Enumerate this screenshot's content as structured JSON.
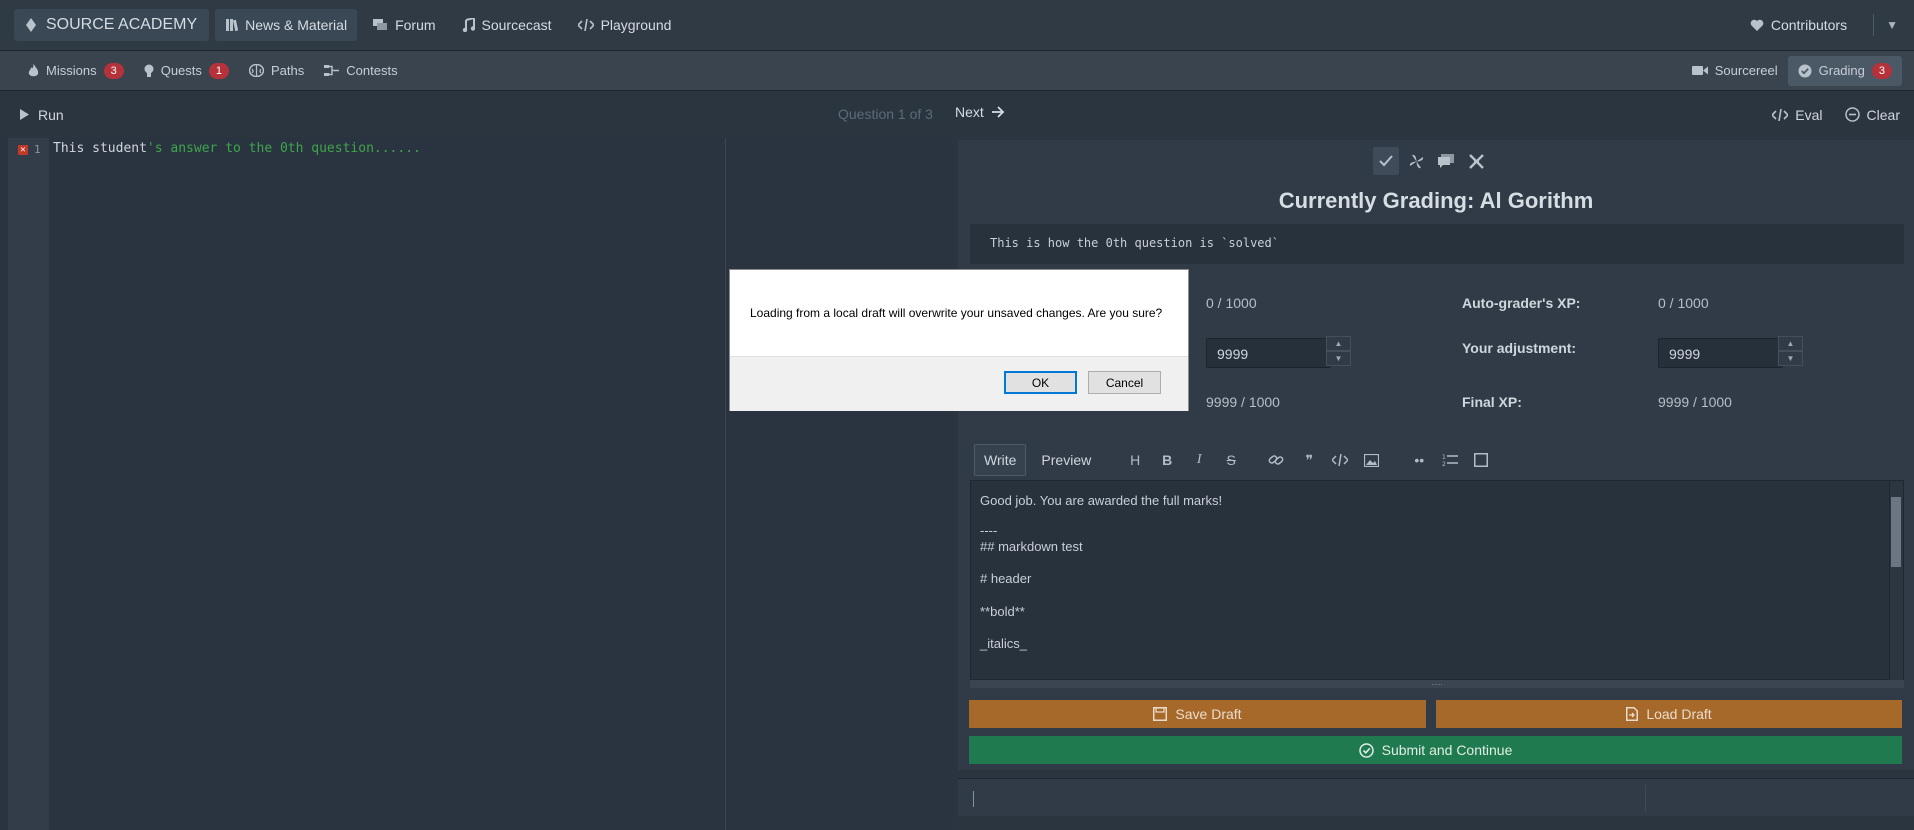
{
  "topbar": {
    "brand": "SOURCE ACADEMY",
    "nav": [
      {
        "label": "News & Material",
        "icon": "book-icon"
      },
      {
        "label": "Forum",
        "icon": "forum-icon"
      },
      {
        "label": "Sourcecast",
        "icon": "music-icon"
      },
      {
        "label": "Playground",
        "icon": "code-icon"
      }
    ],
    "contributors": "Contributors"
  },
  "secbar": {
    "missions": {
      "label": "Missions",
      "count": "3"
    },
    "quests": {
      "label": "Quests",
      "count": "1"
    },
    "paths": {
      "label": "Paths"
    },
    "contests": {
      "label": "Contests"
    },
    "sourcereel": {
      "label": "Sourcereel"
    },
    "grading": {
      "label": "Grading",
      "count": "3"
    }
  },
  "workbar": {
    "run": "Run",
    "question_info": "Question 1 of 3",
    "next": "Next",
    "eval": "Eval",
    "clear": "Clear"
  },
  "editor": {
    "line_number": "1",
    "code_part1": "This student",
    "code_part2": "'s answer to the 0th question......"
  },
  "grading": {
    "title": "Currently Grading: Al Gorithm",
    "solution": "This is how the 0th question is `solved`",
    "left_xp_value": "0 / 1000",
    "left_adjustment": "9999",
    "left_final": "9999 / 1000",
    "autograder_label": "Auto-grader's XP:",
    "autograder_value": "0 / 1000",
    "adjustment_label": "Your adjustment:",
    "adjustment_value": "9999",
    "final_label": "Final XP:",
    "final_value": "9999 / 1000",
    "tab_write": "Write",
    "tab_preview": "Preview",
    "comment_lines": [
      "Good job. You are awarded the full marks!",
      "----",
      "## markdown test",
      "# header",
      "**bold**",
      "_italics_"
    ],
    "save_draft": "Save Draft",
    "load_draft": "Load Draft",
    "submit": "Submit and Continue"
  },
  "dialog": {
    "message": "Loading from a local draft will overwrite your unsaved changes. Are you sure?",
    "ok": "OK",
    "cancel": "Cancel"
  },
  "colors": {
    "badge": "#b5323a",
    "save_button": "#a6692a",
    "submit_button": "#1f7a4f",
    "code_string": "#3fa54a"
  }
}
